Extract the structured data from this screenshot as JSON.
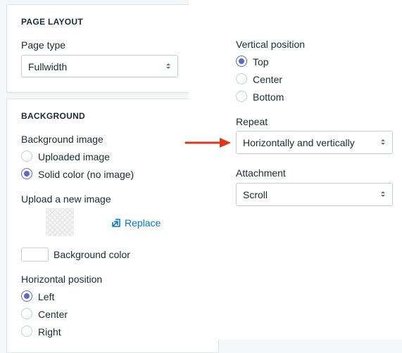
{
  "page_layout": {
    "heading": "PAGE LAYOUT",
    "page_type_label": "Page type",
    "page_type_value": "Fullwidth"
  },
  "background": {
    "heading": "BACKGROUND",
    "image_label": "Background image",
    "image_options": [
      "Uploaded image",
      "Solid color (no image)"
    ],
    "image_selected": "Solid color (no image)",
    "upload_label": "Upload a new image",
    "replace_label": "Replace",
    "color_label": "Background color",
    "hpos_label": "Horizontal position",
    "hpos_options": [
      "Left",
      "Center",
      "Right"
    ],
    "hpos_selected": "Left"
  },
  "right_panel": {
    "vpos_label": "Vertical position",
    "vpos_options": [
      "Top",
      "Center",
      "Bottom"
    ],
    "vpos_selected": "Top",
    "repeat_label": "Repeat",
    "repeat_value": "Horizontally and vertically",
    "attachment_label": "Attachment",
    "attachment_value": "Scroll"
  },
  "colors": {
    "accent": "#5c6ac4",
    "link": "#007ace",
    "arrow": "#de3618"
  },
  "icons": [
    "chevron-updown-icon",
    "upload-icon",
    "arrow-right-icon"
  ]
}
